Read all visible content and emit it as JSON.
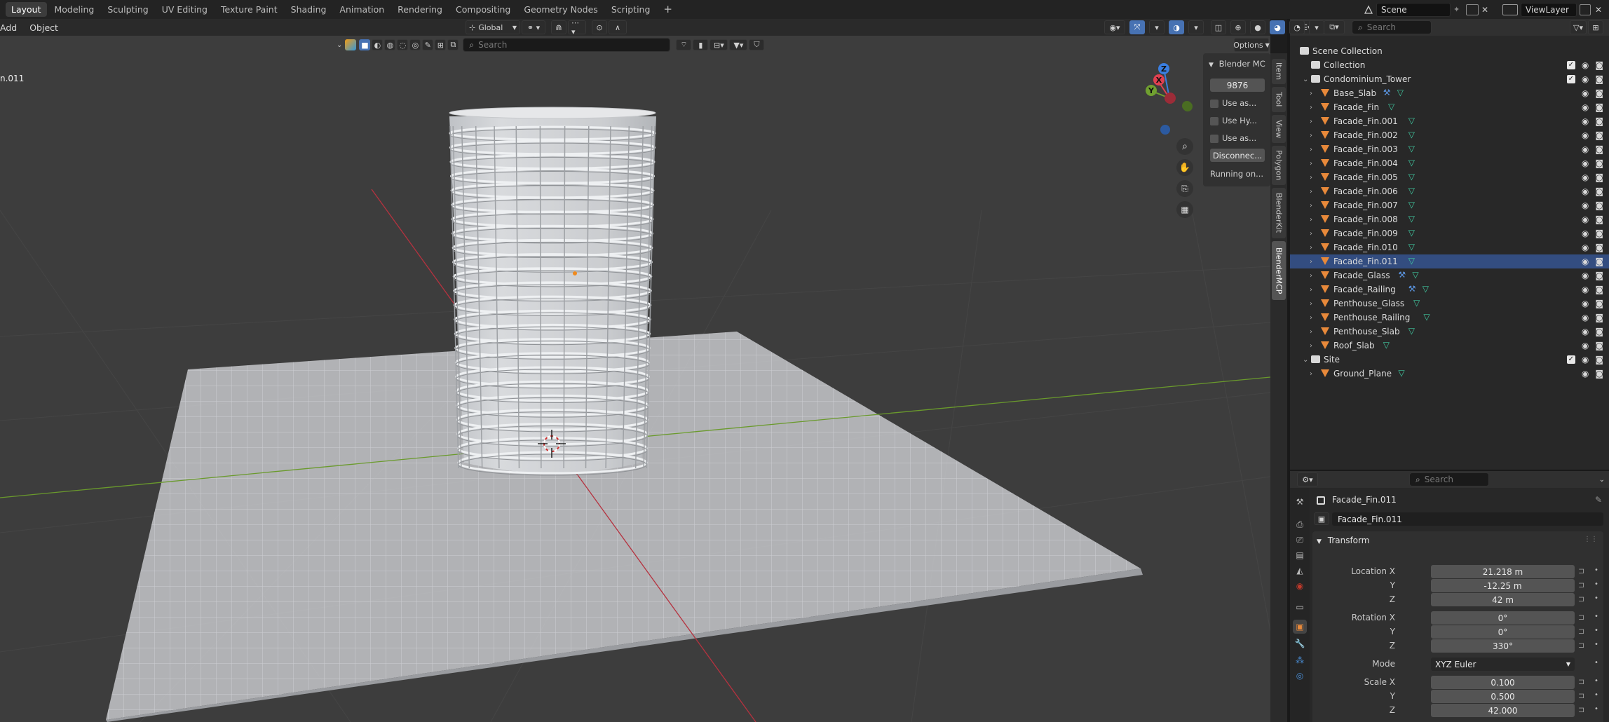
{
  "workspaces": [
    "Layout",
    "Modeling",
    "Sculpting",
    "UV Editing",
    "Texture Paint",
    "Shading",
    "Animation",
    "Rendering",
    "Compositing",
    "Geometry Nodes",
    "Scripting"
  ],
  "add_workspace": "+",
  "scene": {
    "name": "Scene",
    "view_layer": "ViewLayer"
  },
  "viewport": {
    "menus": [
      "Add",
      "Object"
    ],
    "transform_orientation": "Global",
    "object_label": "n.011",
    "search_placeholder": "Search",
    "options_label": "Options"
  },
  "npanel": {
    "title": "Blender MC",
    "port": "9876",
    "checkbox1": "Use as...",
    "checkbox2": "Use Hy...",
    "checkbox3": "Use as...",
    "button": "Disconnec...",
    "status": "Running on...",
    "tabs": [
      "Item",
      "Tool",
      "View",
      "Polygon",
      "BlenderKit",
      "BlenderMCP"
    ]
  },
  "outliner": {
    "search_placeholder": "Search",
    "rows": [
      {
        "name": "Scene Collection",
        "type": "scene"
      },
      {
        "name": "Collection",
        "type": "collection"
      },
      {
        "name": "Condominium_Tower",
        "type": "collection"
      },
      {
        "name": "Base_Slab",
        "type": "object",
        "modifier": true
      },
      {
        "name": "Facade_Fin",
        "type": "object"
      },
      {
        "name": "Facade_Fin.001",
        "type": "object"
      },
      {
        "name": "Facade_Fin.002",
        "type": "object"
      },
      {
        "name": "Facade_Fin.003",
        "type": "object"
      },
      {
        "name": "Facade_Fin.004",
        "type": "object"
      },
      {
        "name": "Facade_Fin.005",
        "type": "object"
      },
      {
        "name": "Facade_Fin.006",
        "type": "object"
      },
      {
        "name": "Facade_Fin.007",
        "type": "object"
      },
      {
        "name": "Facade_Fin.008",
        "type": "object"
      },
      {
        "name": "Facade_Fin.009",
        "type": "object"
      },
      {
        "name": "Facade_Fin.010",
        "type": "object"
      },
      {
        "name": "Facade_Fin.011",
        "type": "object",
        "selected": true
      },
      {
        "name": "Facade_Glass",
        "type": "object",
        "modifier": true
      },
      {
        "name": "Facade_Railing",
        "type": "object",
        "modifier": true
      },
      {
        "name": "Penthouse_Glass",
        "type": "object"
      },
      {
        "name": "Penthouse_Railing",
        "type": "object"
      },
      {
        "name": "Penthouse_Slab",
        "type": "object"
      },
      {
        "name": "Roof_Slab",
        "type": "object"
      },
      {
        "name": "Site",
        "type": "collection"
      },
      {
        "name": "Ground_Plane",
        "type": "object"
      }
    ]
  },
  "properties": {
    "search_placeholder": "Search",
    "object_name": "Facade_Fin.011",
    "datablock_name": "Facade_Fin.011",
    "transform_title": "Transform",
    "location_label": "Location X",
    "loc_x": "21.218 m",
    "loc_y": "-12.25 m",
    "loc_z": "42 m",
    "rotation_label": "Rotation X",
    "rot_x": "0°",
    "rot_y": "0°",
    "rot_z": "330°",
    "mode_label": "Mode",
    "mode": "XYZ Euler",
    "scale_label": "Scale X",
    "scale_x": "0.100",
    "scale_y": "0.500",
    "scale_z": "42.000",
    "y_label": "Y",
    "z_label": "Z"
  },
  "colors": {
    "accent": "#4772b3",
    "object_orange": "#e8893a",
    "mesh_green": "#40c8a0",
    "x_axis": "#e04050",
    "y_axis": "#70a030",
    "z_axis": "#3a7ee0"
  }
}
